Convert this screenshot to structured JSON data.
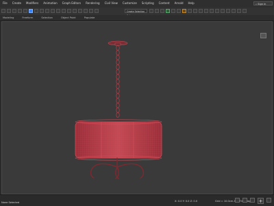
{
  "menubar": {
    "items": [
      "File",
      "Create",
      "Modifiers",
      "Animation",
      "Graph Editors",
      "Rendering",
      "Civil View",
      "Customize",
      "Scripting",
      "Content",
      "Arnold",
      "Help"
    ],
    "search_placeholder": "Sign in"
  },
  "toolbar": {
    "dropdown_value": "Create Selection Set"
  },
  "tabs": {
    "items": [
      "Modeling",
      "Freeform",
      "Selection",
      "Object Paint",
      "Populate"
    ]
  },
  "viewport": {
    "label": ""
  },
  "status": {
    "left": "None Selected",
    "mid": "X: 0.0  Y: 0.0  Z: 0.0",
    "right": "Grid = 10.0cm  Add Time Tag"
  },
  "icons": {
    "menu": "menu-icon",
    "search": "search-icon",
    "viewcube": "viewcube-icon",
    "add": "plus-icon"
  },
  "colors": {
    "accent": "#3a86ff",
    "wire": "#d34b57",
    "shade": "#b94050"
  }
}
